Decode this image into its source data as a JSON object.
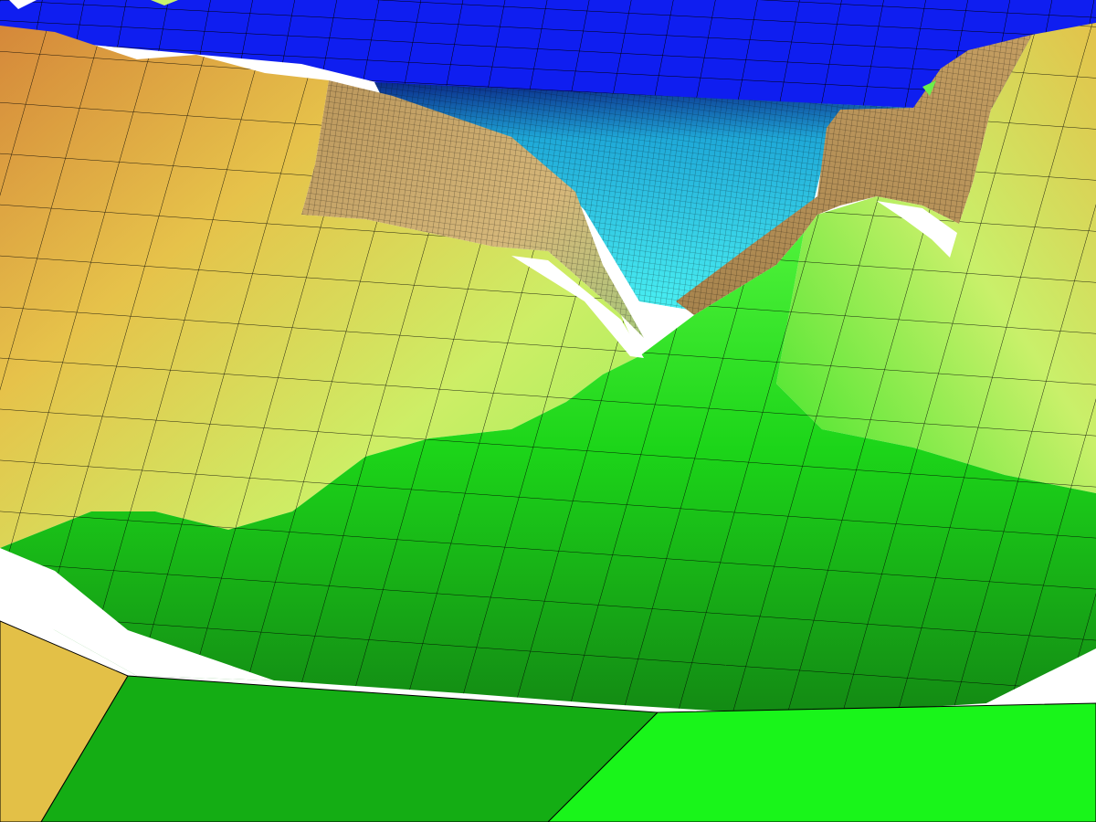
{
  "scene": {
    "description_tag": "terrain-mesh-render",
    "colors": {
      "water_far": "#0f1ef0",
      "water_near": "#36e6ec",
      "cliff": "#c9a96a",
      "terrain_high_orange": "#d3893a",
      "terrain_high_gold": "#e3c047",
      "terrain_mid_yellowgreen": "#c9f36b",
      "terrain_green_light": "#7cf45a",
      "terrain_green": "#1fe51a",
      "terrain_green_dark": "#13a114",
      "background": "#ffffff",
      "gridline": "#000000"
    }
  }
}
